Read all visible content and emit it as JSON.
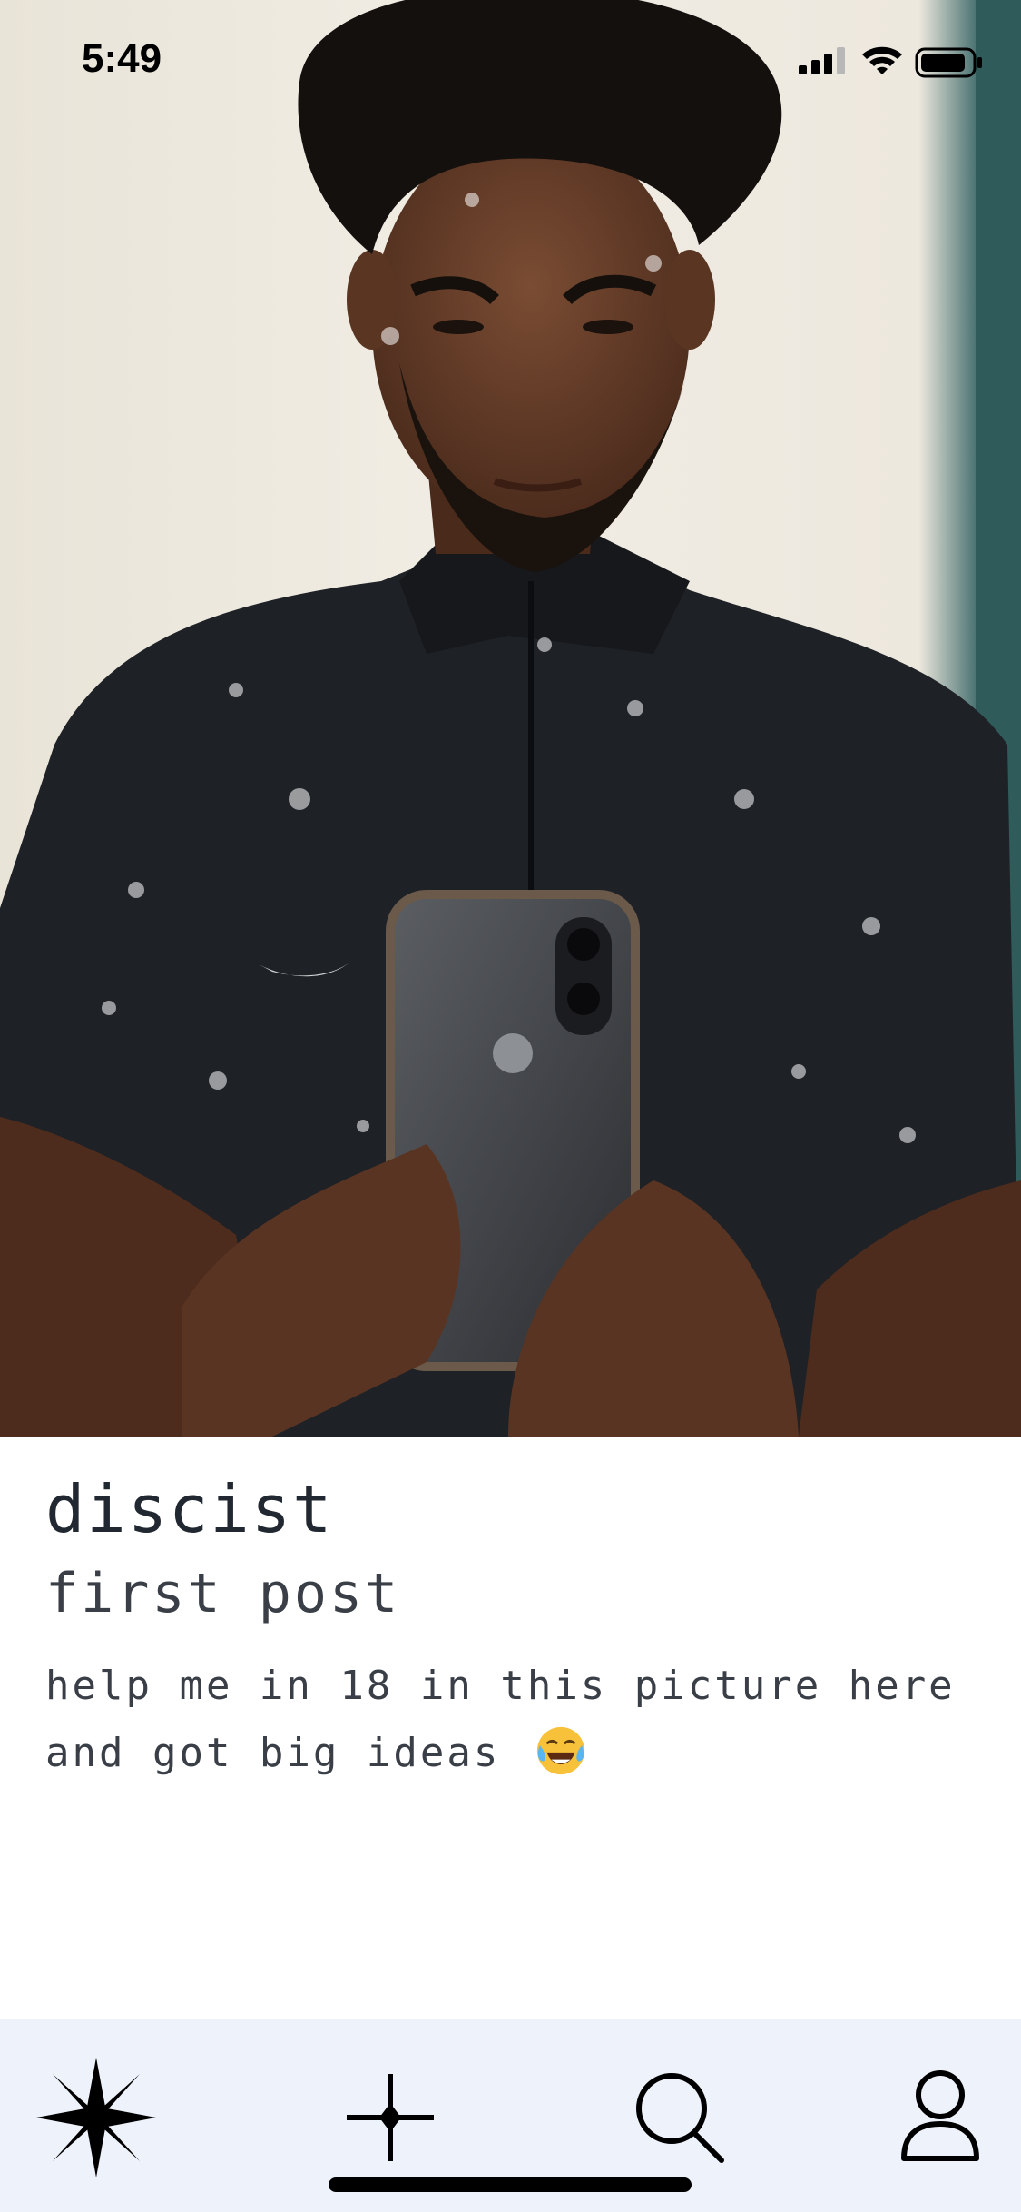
{
  "status_bar": {
    "time": "5:49",
    "signal_icon": "cellular-signal-icon",
    "wifi_icon": "wifi-icon",
    "battery_icon": "battery-icon"
  },
  "post": {
    "username": "discist",
    "title": "first post",
    "body": "help me in 18 in this picture here and got big ideas",
    "body_emoji": "face-with-tears-of-joy-emoji"
  },
  "tab_bar": {
    "items": [
      {
        "name": "explore",
        "icon": "compass-star-icon"
      },
      {
        "name": "create",
        "icon": "plus-icon"
      },
      {
        "name": "search",
        "icon": "search-icon"
      },
      {
        "name": "profile",
        "icon": "profile-icon"
      }
    ]
  },
  "colors": {
    "tab_bar_background": "#eef2fa",
    "text_primary": "#222831",
    "text_secondary": "#3a3f47"
  }
}
